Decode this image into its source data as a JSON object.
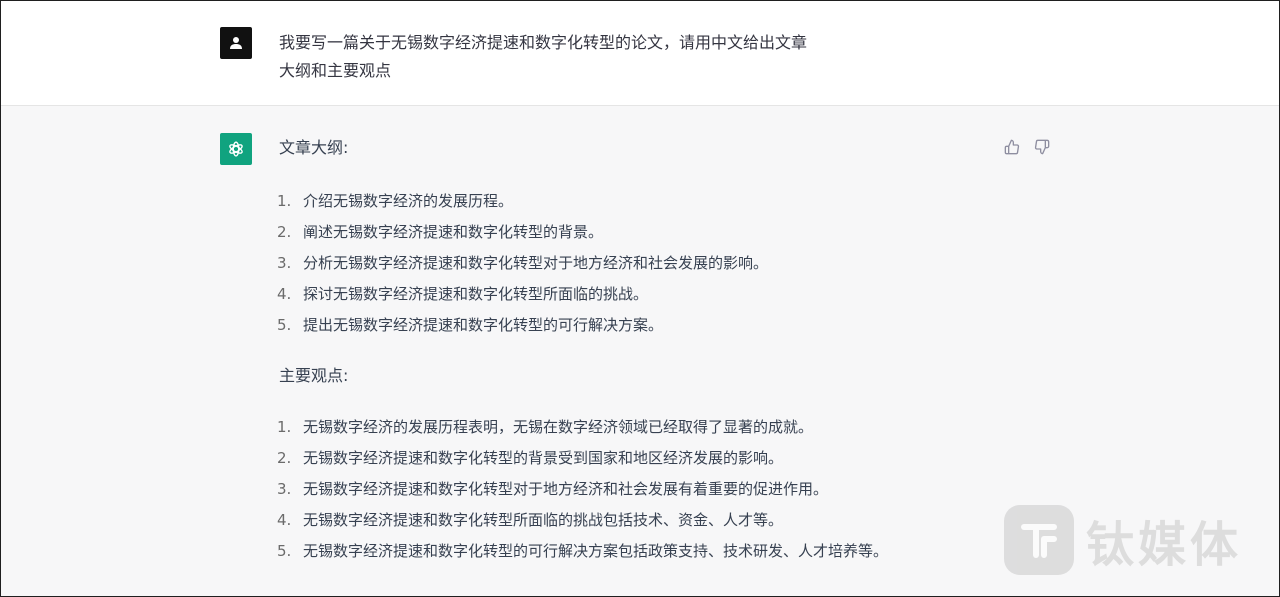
{
  "conversation": {
    "user_message": "我要写一篇关于无锡数字经济提速和数字化转型的论文，请用中文给出文章大纲和主要观点",
    "assistant": {
      "outline_heading": "文章大纲:",
      "outline": [
        {
          "num": "1.",
          "text": "介绍无锡数字经济的发展历程。"
        },
        {
          "num": "2.",
          "text": "阐述无锡数字经济提速和数字化转型的背景。"
        },
        {
          "num": "3.",
          "text": "分析无锡数字经济提速和数字化转型对于地方经济和社会发展的影响。"
        },
        {
          "num": "4.",
          "text": "探讨无锡数字经济提速和数字化转型所面临的挑战。"
        },
        {
          "num": "5.",
          "text": "提出无锡数字经济提速和数字化转型的可行解决方案。"
        }
      ],
      "points_heading": "主要观点:",
      "points": [
        {
          "num": "1.",
          "text": "无锡数字经济的发展历程表明，无锡在数字经济领域已经取得了显著的成就。"
        },
        {
          "num": "2.",
          "text": "无锡数字经济提速和数字化转型的背景受到国家和地区经济发展的影响。"
        },
        {
          "num": "3.",
          "text": "无锡数字经济提速和数字化转型对于地方经济和社会发展有着重要的促进作用。"
        },
        {
          "num": "4.",
          "text": "无锡数字经济提速和数字化转型所面临的挑战包括技术、资金、人才等。"
        },
        {
          "num": "5.",
          "text": "无锡数字经济提速和数字化转型的可行解决方案包括政策支持、技术研发、人才培养等。"
        }
      ]
    }
  },
  "icons": {
    "user_avatar": "user-icon",
    "assistant_avatar": "openai-logo-icon",
    "thumbs_up": "thumbs-up-icon",
    "thumbs_down": "thumbs-down-icon"
  },
  "watermark": {
    "text": "钛媒体"
  },
  "colors": {
    "assistant_avatar_bg": "#10a37f",
    "user_avatar_bg": "#111111",
    "assistant_row_bg": "#f7f7f8"
  }
}
